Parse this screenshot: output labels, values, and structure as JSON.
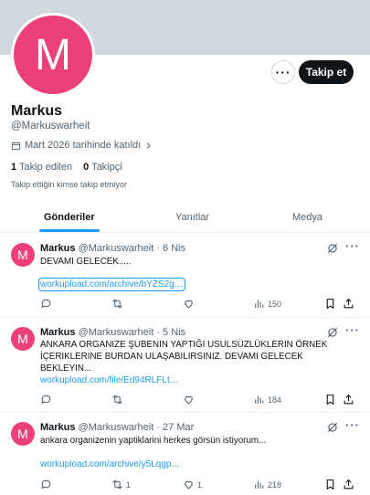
{
  "profile": {
    "avatar_letter": "M",
    "name": "Markus",
    "handle": "@Markuswarheit",
    "joined": "Mart 2026 tarihinde katıldı",
    "following_count": "1",
    "following_label": "Takip edilen",
    "followers_count": "0",
    "followers_label": "Takipçi",
    "nobody_followed": "Takip ettiğin kimse takip etmiyor",
    "more_label": "···",
    "follow_label": "Takip et"
  },
  "tabs": [
    {
      "label": "Gönderiler",
      "active": true
    },
    {
      "label": "Yanıtlar",
      "active": false
    },
    {
      "label": "Medya",
      "active": false
    }
  ],
  "posts": [
    {
      "name": "Markus",
      "meta": "@Markuswarheit · 6 Nis",
      "text": "DEVAMI GELECEK.....",
      "link": "workupload.com/archive/bYZS2g…",
      "replies": "",
      "reposts": "",
      "likes": "",
      "views": "150"
    },
    {
      "name": "Markus",
      "meta": "@Markuswarheit · 5 Nis",
      "text": "ANKARA ORGANIZE ŞUBENIN YAPTIĞI USULSÜZLÜKLERIN  ÖRNEK İÇERIKLERINE BURDAN ULAŞABILIRSINIZ. DEVAMI GELECEK BEKLEYIN...",
      "link": "workupload.com/file/Ed94RLFLt…",
      "replies": "",
      "reposts": "",
      "likes": "",
      "views": "184"
    },
    {
      "name": "Markus",
      "meta": "@Markuswarheit · 27 Mar",
      "text": "ankara organizenin yaptiklarini herkes görsün istiyorum...",
      "link": "workupload.com/archive/y5Lqgp…",
      "replies": "",
      "reposts": "1",
      "likes": "1",
      "views": "218"
    }
  ],
  "colors": {
    "accent": "#1d9bf0",
    "avatar": "#ec407a",
    "banner": "#cfd9de",
    "text": "#0f1419",
    "muted": "#536471"
  }
}
